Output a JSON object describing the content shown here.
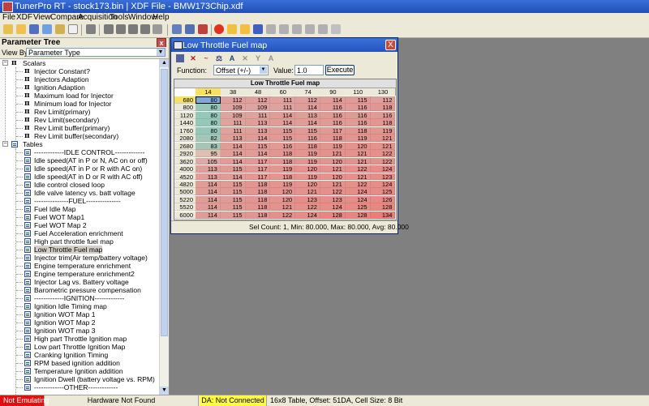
{
  "window": {
    "title": "TunerPro RT - stock173.bin | XDF File - BMW173Chip.xdf"
  },
  "menu": [
    "File",
    "XDF",
    "View",
    "Compare",
    "Acquisition",
    "Tools",
    "Window",
    "Help"
  ],
  "colors": {
    "emulating": "#e01010",
    "da_status": "#ffff40",
    "title_blue": "#2354c0"
  },
  "parameter_tree": {
    "title": "Parameter Tree",
    "close_label": "x",
    "view_by_label": "View By:",
    "view_by_value": "Parameter Type",
    "scalars_label": "Scalars",
    "scalars": [
      "Injector Constant?",
      "Injectors Adaption",
      "Ignition Adaption",
      "Maximum load for Injector",
      "Minimum load for Injector",
      "Rev Limit(primary)",
      "Rev Limit(secondary)",
      "Rev Limit buffer(primary)",
      "Rev Limit buffer(secondary)"
    ],
    "tables_label": "Tables",
    "tables": [
      "-------------IDLE CONTROL-------------",
      "Idle speed(AT in P or N, AC on or off)",
      "Idle speed(AT in P or R with AC on)",
      "Idle speed(AT in D or R with AC off)",
      "Idle control closed loop",
      "Idle valve latency vs. batt voltage",
      "---------------FUEL---------------",
      "Fuel Idle Map",
      "Fuel WOT Map1",
      "Fuel WOT Map 2",
      "Fuel Acceleration enrichment",
      "High part throttle fuel map",
      "Low Throttle Fuel map",
      "Injector trim(Air temp/battery voltage)",
      "Engine temperature enrichment",
      "Engine temperature enrichment2",
      "Injector Lag vs. Battery voltage",
      "Barometric pressure compensation",
      "-------------IGNITION-------------",
      "Ignition Idle Timing map",
      "Ignition WOT Map 1",
      "Ignition WOT Map 2",
      "Ignition WOT map 3",
      "High part Throttle Ignition map",
      "Low part Throttle Ignition Map",
      "Cranking Ignition Timing",
      "RPM based ignition addition",
      "Temperature Ignition addition",
      "Ignition Dwell (battery voltage vs. RPM)",
      "-------------OTHER-------------"
    ],
    "selected": "Low Throttle Fuel map"
  },
  "table_window": {
    "title": "Low Throttle Fuel map",
    "close_label": "X",
    "function_label": "Function:",
    "function_value": "Offset (+/-)",
    "value_label": "Value:",
    "value_value": "1.0",
    "execute_label": "Execute",
    "grid_title": "Low Throttle Fuel map",
    "columns": [
      "14",
      "38",
      "48",
      "60",
      "74",
      "90",
      "110",
      "130"
    ],
    "rows": [
      "680",
      "800",
      "1120",
      "1440",
      "1760",
      "2080",
      "2680",
      "2920",
      "3620",
      "4000",
      "4520",
      "4820",
      "5000",
      "5220",
      "5520",
      "6000"
    ],
    "values": [
      [
        80,
        112,
        112,
        111,
        112,
        114,
        115,
        112
      ],
      [
        80,
        109,
        109,
        111,
        114,
        116,
        116,
        118
      ],
      [
        80,
        109,
        111,
        114,
        113,
        116,
        116,
        116
      ],
      [
        80,
        111,
        113,
        114,
        114,
        116,
        116,
        118
      ],
      [
        80,
        111,
        113,
        115,
        115,
        117,
        118,
        119
      ],
      [
        82,
        113,
        114,
        115,
        116,
        118,
        119,
        121
      ],
      [
        83,
        114,
        115,
        116,
        118,
        119,
        120,
        121
      ],
      [
        95,
        114,
        114,
        118,
        119,
        121,
        121,
        122
      ],
      [
        105,
        114,
        117,
        118,
        119,
        120,
        121,
        122
      ],
      [
        113,
        115,
        117,
        119,
        120,
        121,
        122,
        124
      ],
      [
        113,
        114,
        117,
        118,
        119,
        120,
        121,
        123
      ],
      [
        114,
        115,
        118,
        119,
        120,
        121,
        122,
        124
      ],
      [
        114,
        115,
        118,
        120,
        121,
        122,
        124,
        125
      ],
      [
        114,
        115,
        118,
        120,
        123,
        123,
        124,
        126
      ],
      [
        114,
        115,
        118,
        121,
        122,
        124,
        125,
        128
      ],
      [
        114,
        115,
        118,
        122,
        124,
        128,
        128,
        134
      ]
    ],
    "status": "Sel Count: 1, Min: 80.000, Max: 80.000, Avg: 80.000"
  },
  "statusbar": {
    "emulation": "Not Emulating",
    "hardware": "Hardware Not Found",
    "da": "DA: Not Connected",
    "table_info": "16x8 Table, Offset: 51DA,  Cell Size: 8 Bit"
  }
}
